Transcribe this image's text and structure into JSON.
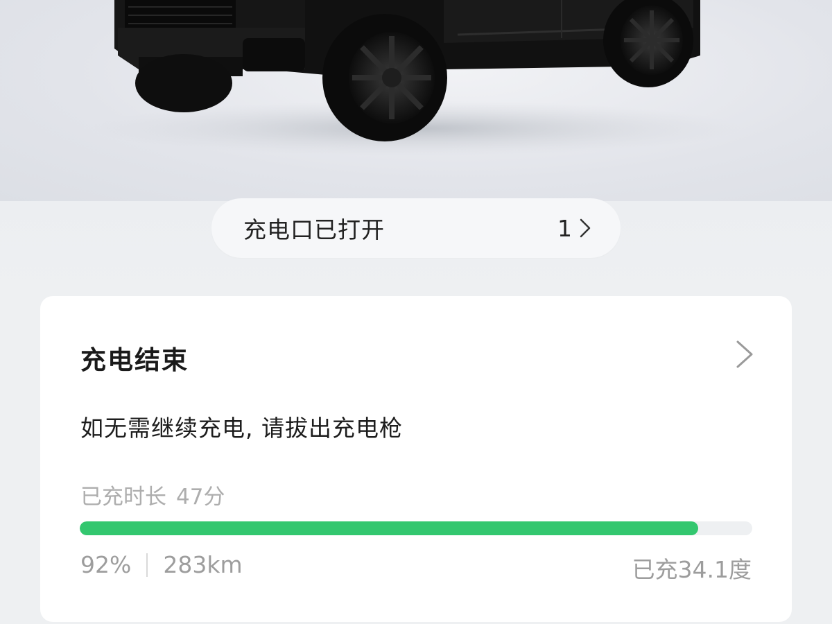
{
  "status_pill": {
    "label": "充电口已打开",
    "count": "1"
  },
  "card": {
    "title": "充电结束",
    "description": "如无需继续充电, 请拔出充电枪",
    "duration_label": "已充时长",
    "duration_value": "47分",
    "progress_percent": 92,
    "battery_percent": "92%",
    "range": "283km",
    "charged_energy": "已充34.1度"
  },
  "colors": {
    "accent_green": "#33c76f",
    "card_bg": "#ffffff",
    "page_bg": "#eef0f2"
  },
  "icons": {
    "pill_chevron": "chevron-right-icon",
    "card_chevron": "chevron-right-icon"
  }
}
